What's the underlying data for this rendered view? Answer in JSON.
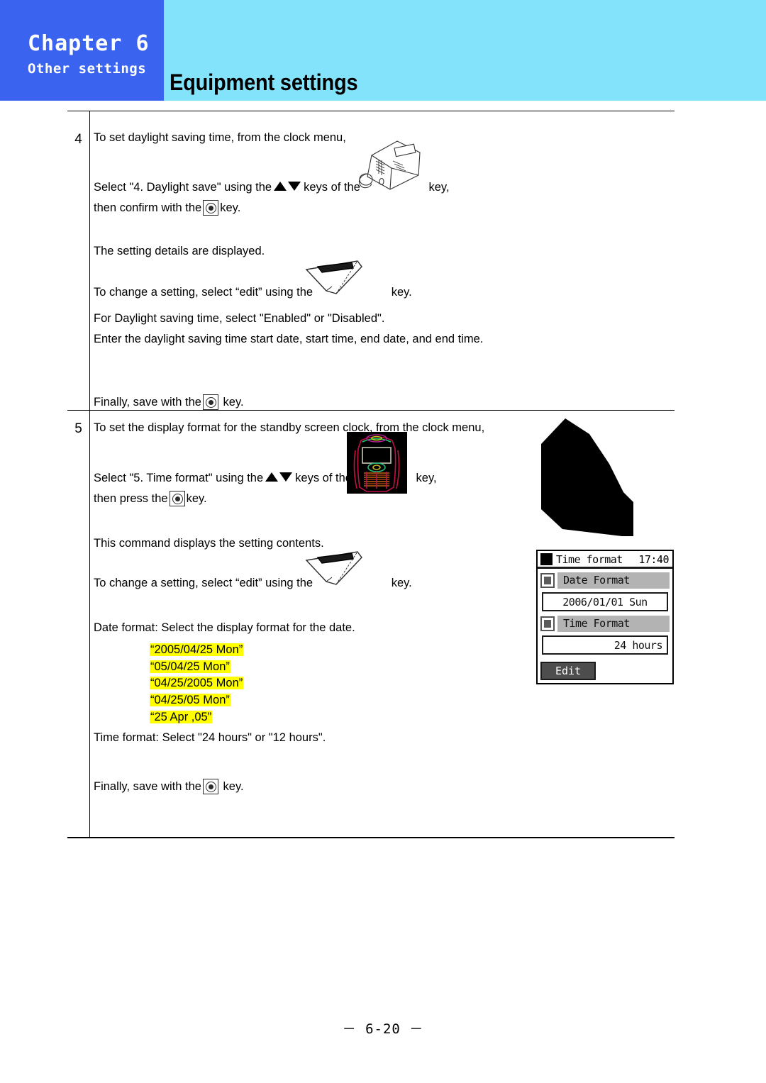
{
  "header": {
    "chapter_label": "Chapter 6",
    "chapter_sub": "Other settings",
    "title": "Equipment settings",
    "chapter_block_color": "#3a64f0",
    "band_color": "#82e3fb"
  },
  "steps": [
    {
      "number": "4",
      "lines": [
        "To set daylight saving time, from the clock menu,",
        "Select \"4. Daylight save\" using the",
        "keys of the",
        "key,",
        "then confirm with the",
        "key.",
        "The setting details are displayed.",
        "To change a setting, select “edit” using the",
        "key.",
        "For Daylight saving time, select \"Enabled\" or \"Disabled\".",
        "Enter the daylight saving time start date, start time, end date, and end time.",
        "Finally, save with the",
        "key."
      ],
      "line1": "To set daylight saving time, from the clock menu,",
      "select_prefix": "Select \"4. Daylight save\" using the",
      "keys_of_the": "keys of the",
      "key_comma": "key,",
      "then_confirm": "then confirm with the",
      "key_period": "key.",
      "details_displayed": "The setting details are displayed.",
      "change_setting": "To change a setting, select “edit” using the",
      "enabled_disabled": "For Daylight saving time, select \"Enabled\" or \"Disabled\".",
      "enter_dst": "Enter the daylight saving time start date, start time, end date, and end time.",
      "finally_save": "Finally, save with the"
    },
    {
      "number": "5",
      "line1": "To set the display format for the standby screen clock, from the clock menu,",
      "select_prefix": "Select \"5. Time format\" using the",
      "keys_of_the": "keys of the",
      "key_comma": "key,",
      "then_press": "then press the",
      "key_period": "key.",
      "command_displays": "This command displays the setting contents.",
      "change_setting": "To change a setting, select “edit” using the",
      "date_format_line": "Date format:  Select the display format for the date.",
      "date_format_options": [
        "“2005/04/25 Mon”",
        "“05/04/25 Mon”",
        "“04/25/2005 Mon”",
        "“04/25/05 Mon”",
        "“25 Apr ,05”"
      ],
      "time_format_line": "Time format:  Select \"24 hours\" or \"12 hours\".",
      "finally_save": "Finally, save with the",
      "highlight_color": "#ffff00"
    }
  ],
  "lcd": {
    "title": "Time format",
    "time": "17:40",
    "rows": [
      {
        "label": "Date Format",
        "value": "2006/01/01 Sun",
        "value_align": "center"
      },
      {
        "label": "Time Format",
        "value": "24 hours",
        "value_align": "right"
      }
    ],
    "edit_button": "Edit"
  },
  "icons": {
    "enter_key": "enter-key-icon",
    "arrow_up": "arrow-up-icon",
    "arrow_down": "arrow-down-icon",
    "desk_phone": "desk-phone-illustration",
    "soft_key": "soft-key-illustration",
    "mobile_phone": "mobile-phone-illustration",
    "black_shape": "black-polygon-artifact"
  },
  "footer": {
    "page_number": "－ 6-20 －"
  }
}
